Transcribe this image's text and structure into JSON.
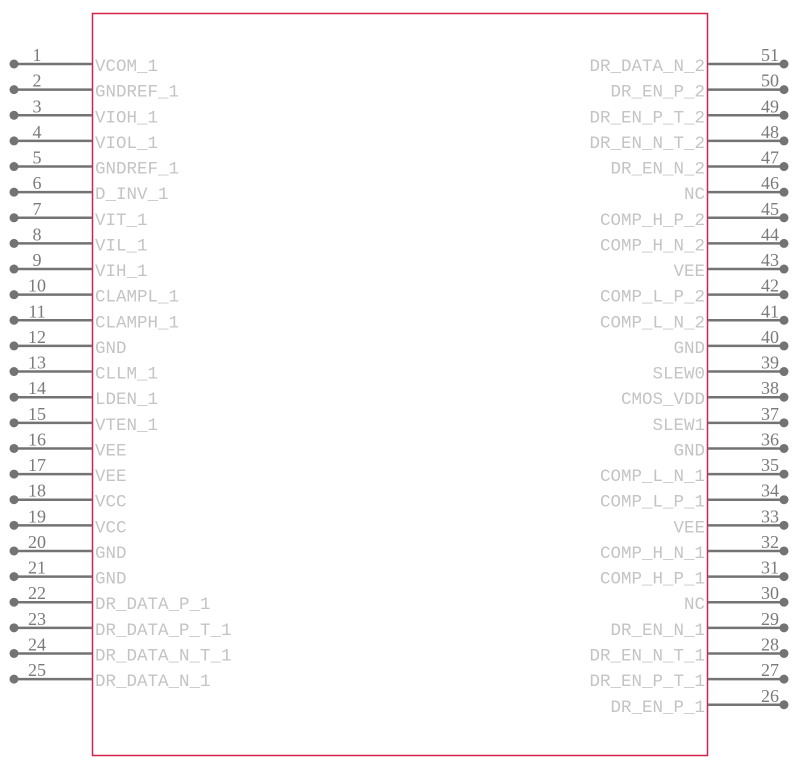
{
  "colors": {
    "body_outline": "#d4234a",
    "pin": "#737373",
    "label": "#c4c4c4",
    "number": "#7a7a7a"
  },
  "left_pins": [
    {
      "num": "1",
      "name": "VCOM_1"
    },
    {
      "num": "2",
      "name": "GNDREF_1"
    },
    {
      "num": "3",
      "name": "VIOH_1"
    },
    {
      "num": "4",
      "name": "VIOL_1"
    },
    {
      "num": "5",
      "name": "GNDREF_1"
    },
    {
      "num": "6",
      "name": "D_INV_1"
    },
    {
      "num": "7",
      "name": "VIT_1"
    },
    {
      "num": "8",
      "name": "VIL_1"
    },
    {
      "num": "9",
      "name": "VIH_1"
    },
    {
      "num": "10",
      "name": "CLAMPL_1"
    },
    {
      "num": "11",
      "name": "CLAMPH_1"
    },
    {
      "num": "12",
      "name": "GND"
    },
    {
      "num": "13",
      "name": "CLLM_1"
    },
    {
      "num": "14",
      "name": "LDEN_1"
    },
    {
      "num": "15",
      "name": "VTEN_1"
    },
    {
      "num": "16",
      "name": "VEE"
    },
    {
      "num": "17",
      "name": "VEE"
    },
    {
      "num": "18",
      "name": "VCC"
    },
    {
      "num": "19",
      "name": "VCC"
    },
    {
      "num": "20",
      "name": "GND"
    },
    {
      "num": "21",
      "name": "GND"
    },
    {
      "num": "22",
      "name": "DR_DATA_P_1"
    },
    {
      "num": "23",
      "name": "DR_DATA_P_T_1"
    },
    {
      "num": "24",
      "name": "DR_DATA_N_T_1"
    },
    {
      "num": "25",
      "name": "DR_DATA_N_1"
    }
  ],
  "right_pins": [
    {
      "num": "51",
      "name": "DR_DATA_N_2"
    },
    {
      "num": "50",
      "name": "DR_EN_P_2"
    },
    {
      "num": "49",
      "name": "DR_EN_P_T_2"
    },
    {
      "num": "48",
      "name": "DR_EN_N_T_2"
    },
    {
      "num": "47",
      "name": "DR_EN_N_2"
    },
    {
      "num": "46",
      "name": "NC"
    },
    {
      "num": "45",
      "name": "COMP_H_P_2"
    },
    {
      "num": "44",
      "name": "COMP_H_N_2"
    },
    {
      "num": "43",
      "name": "VEE"
    },
    {
      "num": "42",
      "name": "COMP_L_P_2"
    },
    {
      "num": "41",
      "name": "COMP_L_N_2"
    },
    {
      "num": "40",
      "name": "GND"
    },
    {
      "num": "39",
      "name": "SLEW0"
    },
    {
      "num": "38",
      "name": "CMOS_VDD"
    },
    {
      "num": "37",
      "name": "SLEW1"
    },
    {
      "num": "36",
      "name": "GND"
    },
    {
      "num": "35",
      "name": "COMP_L_N_1"
    },
    {
      "num": "34",
      "name": "COMP_L_P_1"
    },
    {
      "num": "33",
      "name": "VEE"
    },
    {
      "num": "32",
      "name": "COMP_H_N_1"
    },
    {
      "num": "31",
      "name": "COMP_H_P_1"
    },
    {
      "num": "30",
      "name": "NC"
    },
    {
      "num": "29",
      "name": "DR_EN_N_1"
    },
    {
      "num": "28",
      "name": "DR_EN_N_T_1"
    },
    {
      "num": "27",
      "name": "DR_EN_P_T_1"
    },
    {
      "num": "26",
      "name": "DR_EN_P_1"
    }
  ]
}
